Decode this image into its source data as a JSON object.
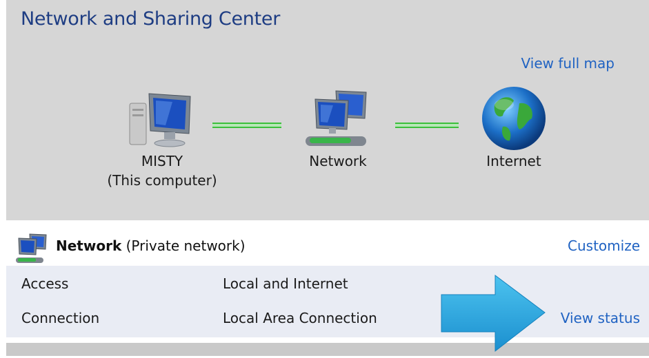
{
  "window": {
    "title": "Network and Sharing Center"
  },
  "map": {
    "view_full_map_label": "View full map",
    "nodes": [
      {
        "name": "MISTY",
        "sub": "(This computer)",
        "icon": "computer-icon"
      },
      {
        "name": "Network",
        "icon": "network-icon"
      },
      {
        "name": "Internet",
        "icon": "globe-icon"
      }
    ],
    "connector_color": "#3bbf3b"
  },
  "network": {
    "icon": "network-icon",
    "name": "Network",
    "type": "(Private network)",
    "customize_label": "Customize",
    "rows": [
      {
        "label": "Access",
        "value": "Local and Internet"
      },
      {
        "label": "Connection",
        "value": "Local Area Connection",
        "action": "View status"
      }
    ]
  },
  "colors": {
    "title": "#1e3d83",
    "link": "#1f62c2",
    "arrow": "#29a8e0",
    "panel_bg": "#d6d6d6"
  }
}
